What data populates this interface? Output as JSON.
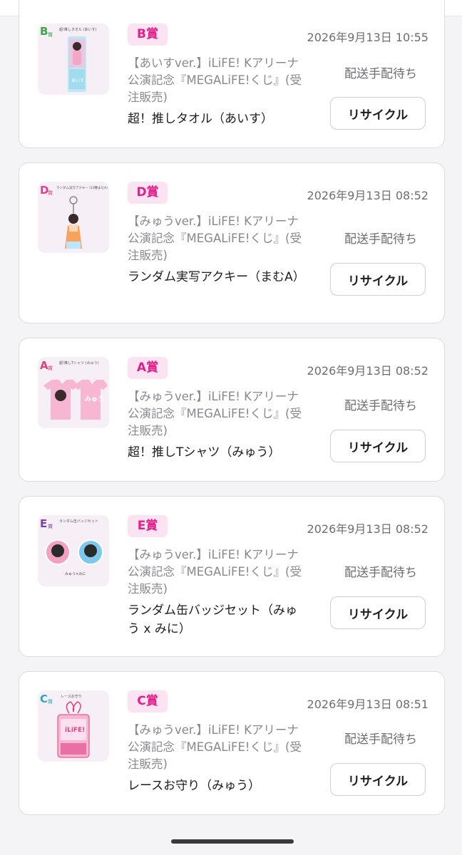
{
  "cards": [
    {
      "prize": "B賞",
      "datetime": "2026年9月13日 10:55",
      "series": "【あいすver.】iLiFE! Kアリーナ公演記念『MEGALiFE!くじ』(受注販売)",
      "item": "超！推しタオル（あいす）",
      "status": "配送手配待ち",
      "button": "リサイクル",
      "thumb": {
        "letter": "B",
        "color": "#3fa34d",
        "caption": "超!推しタオル (あいす)"
      }
    },
    {
      "prize": "D賞",
      "datetime": "2026年9月13日 08:52",
      "series": "【みゅうver.】iLiFE! Kアリーナ公演記念『MEGALiFE!くじ』(受注販売)",
      "item": "ランダム実写アクキー（まむA）",
      "status": "配送手配待ち",
      "button": "リサイクル",
      "thumb": {
        "letter": "D",
        "color": "#e0408c",
        "caption": "ランダム実写アクキー (10種まむA)"
      }
    },
    {
      "prize": "A賞",
      "datetime": "2026年9月13日 08:52",
      "series": "【みゅうver.】iLiFE! Kアリーナ公演記念『MEGALiFE!くじ』(受注販売)",
      "item": "超！推しTシャツ（みゅう）",
      "status": "配送手配待ち",
      "button": "リサイクル",
      "thumb": {
        "letter": "A",
        "color": "#e0407a",
        "caption": "超!推しTシャツ (みゅう)"
      }
    },
    {
      "prize": "E賞",
      "datetime": "2026年9月13日 08:52",
      "series": "【みゅうver.】iLiFE! Kアリーナ公演記念『MEGALiFE!くじ』(受注販売)",
      "item": "ランダム缶バッジセット（みゅう x みに）",
      "status": "配送手配待ち",
      "button": "リサイクル",
      "thumb": {
        "letter": "E",
        "color": "#7a3fa8",
        "caption": "ランダム缶バッジセット",
        "sub": "みゅう×みに"
      }
    },
    {
      "prize": "C賞",
      "datetime": "2026年9月13日 08:51",
      "series": "【みゅうver.】iLiFE! Kアリーナ公演記念『MEGALiFE!くじ』(受注販売)",
      "item": "レースお守り（みゅう）",
      "status": "配送手配待ち",
      "button": "リサイクル",
      "thumb": {
        "letter": "C",
        "color": "#2aa6c9",
        "caption": "レースお守り",
        "sub": "iLiFE!"
      }
    }
  ]
}
